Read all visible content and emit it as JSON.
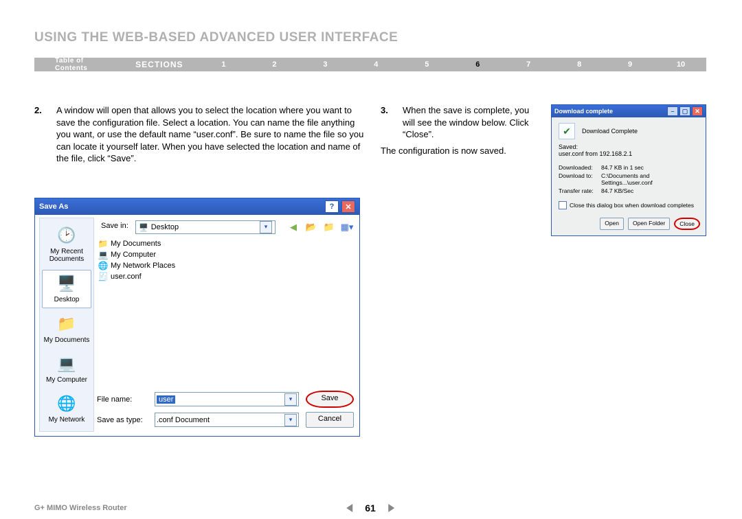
{
  "page": {
    "title": "USING THE WEB-BASED ADVANCED USER INTERFACE",
    "product": "G+ MIMO Wireless Router",
    "page_number": "61"
  },
  "nav": {
    "toc": "Table of Contents",
    "sections": "SECTIONS",
    "items": [
      "1",
      "2",
      "3",
      "4",
      "5",
      "6",
      "7",
      "8",
      "9",
      "10"
    ],
    "active": "6"
  },
  "steps": {
    "s2_num": "2.",
    "s2_text": "A window will open that allows you to select the location where you want to save the configuration file. Select a location. You can name the file anything you want, or use the default name “user.conf”. Be sure to name the file so you can locate it yourself later. When you have selected the location and name of the file, click “Save”.",
    "s3_num": "3.",
    "s3_text": "When the save is complete, you will see the window below. Click “Close”.",
    "saved_msg": "The configuration is now saved."
  },
  "saveas": {
    "title": "Save As",
    "savein_label": "Save in:",
    "savein_value": "Desktop",
    "sidebar": {
      "recent": "My Recent Documents",
      "desktop": "Desktop",
      "mydocs": "My Documents",
      "mycomp": "My Computer",
      "mynet": "My Network"
    },
    "files": {
      "f1": "My Documents",
      "f2": "My Computer",
      "f3": "My Network Places",
      "f4": "user.conf"
    },
    "filename_label": "File name:",
    "filename_value": "user",
    "saveastype_label": "Save as type:",
    "saveastype_value": ".conf Document",
    "save_btn": "Save",
    "cancel_btn": "Cancel"
  },
  "dlc": {
    "title": "Download complete",
    "headline": "Download Complete",
    "saved_label": "Saved:",
    "saved_value": "user.conf from 192.168.2.1",
    "downloaded_label": "Downloaded:",
    "downloaded_value": "84.7 KB in 1 sec",
    "downloadto_label": "Download to:",
    "downloadto_value": "C:\\Documents and Settings...\\user.conf",
    "rate_label": "Transfer rate:",
    "rate_value": "84.7 KB/Sec",
    "checkbox_label": "Close this dialog box when download completes",
    "open_btn": "Open",
    "openfolder_btn": "Open Folder",
    "close_btn": "Close"
  }
}
